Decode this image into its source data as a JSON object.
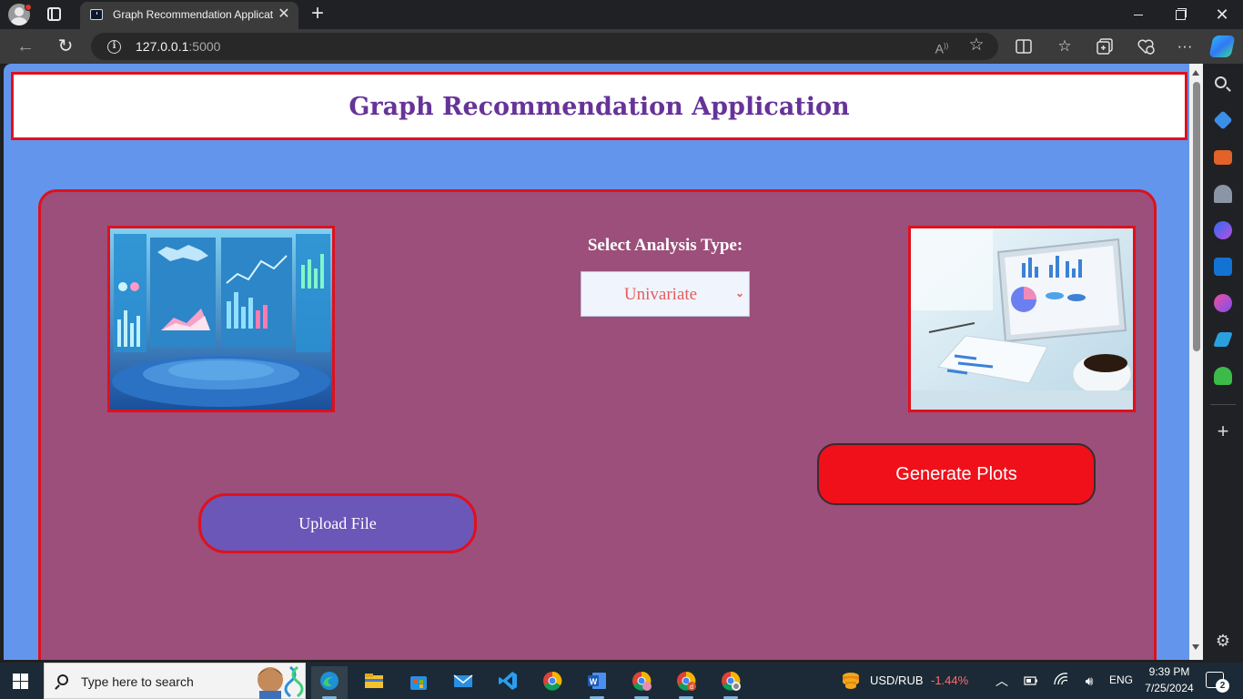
{
  "browser": {
    "tab_title": "Graph Recommendation Application",
    "tab_close": "✕",
    "new_tab": "+",
    "url_host": "127.0.0.1",
    "url_port": ":5000",
    "window_controls": {
      "minimize": "minimize-icon",
      "maximize": "restore-icon",
      "close": "close-icon"
    },
    "toolbar_icons": [
      "split-screen-icon",
      "favorites-icon",
      "collections-icon",
      "browser-essentials-icon",
      "more-icon",
      "copilot-icon"
    ],
    "sidebar_icons": [
      "search-icon",
      "shopping-icon",
      "tools-icon",
      "games-icon",
      "microsoft-365-icon",
      "outlook-icon",
      "designer-icon",
      "telegram-icon",
      "tree-icon",
      "add-icon",
      "settings-icon"
    ]
  },
  "app": {
    "title": "Graph Recommendation Application",
    "analysis_label": "Select Analysis Type:",
    "analysis_select": {
      "selected": "Univariate"
    },
    "generate_button": "Generate Plots",
    "upload_button": "Upload File",
    "colors": {
      "page_bg": "#6495ed",
      "title": "#663399",
      "border": "#e0101c",
      "panel_bg": "#9b4f7a",
      "generate_bg": "#f0101a",
      "upload_bg": "#6a57b8",
      "select_text": "#e65c5c"
    }
  },
  "taskbar": {
    "search_placeholder": "Type here to search",
    "apps": [
      "edge-icon",
      "file-explorer-icon",
      "microsoft-store-icon",
      "mail-icon",
      "vscode-icon",
      "chrome-icon",
      "word-icon",
      "chrome-profile-icon",
      "chrome-profile-d-icon",
      "chrome-profile-3-icon"
    ],
    "ticker_symbol": "USD/RUB",
    "ticker_change": "-1.44%",
    "language": "ENG",
    "time": "9:39 PM",
    "date": "7/25/2024",
    "notification_count": "2"
  }
}
